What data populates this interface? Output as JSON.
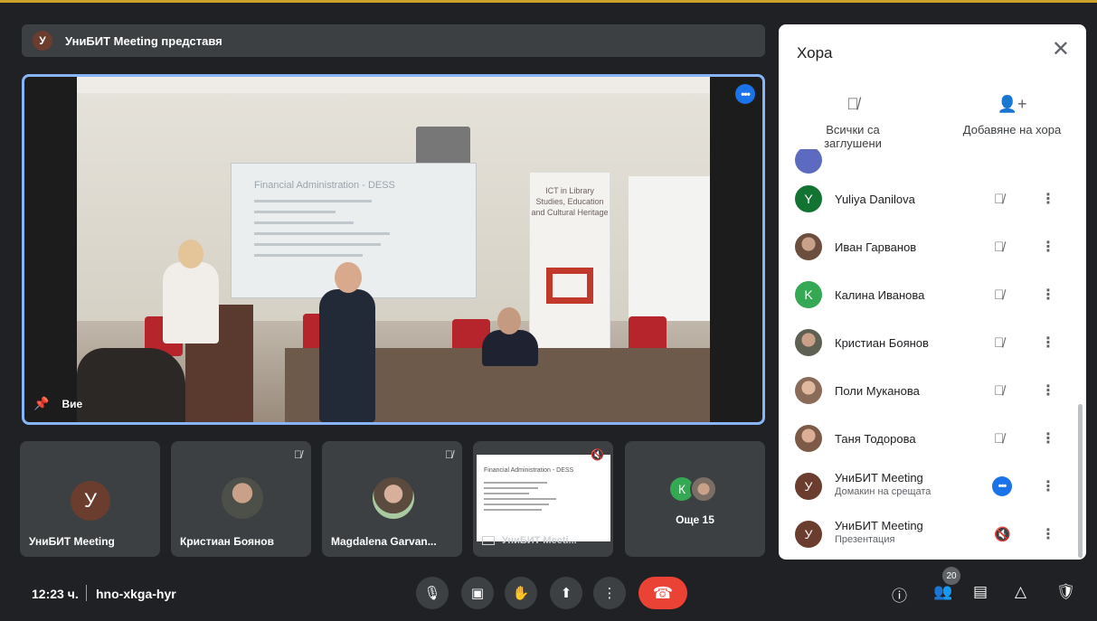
{
  "banner": {
    "avatar_letter": "У",
    "text": "УниБИТ Meeting представя"
  },
  "main_video": {
    "label": "Вие",
    "slide_title": "Financial Administration - DESS",
    "rollup_text": "ICT in Library Studies, Education and Cultural Heritage"
  },
  "tiles": [
    {
      "name": "УниБИТ Meeting",
      "avatar_letter": "У"
    },
    {
      "name": "Кристиан Боянов"
    },
    {
      "name": "Magdalena Garvan..."
    },
    {
      "name": "УниБИТ Meeti...",
      "slide_title": "Financial Administration - DESS"
    },
    {
      "more_label": "Още 15",
      "avatar_letter": "К"
    }
  ],
  "panel": {
    "title": "Хора",
    "mute_all_label": "Всички са заглушени",
    "add_people_label": "Добавяне на хора",
    "people": [
      {
        "name": "Yuliya Danilova",
        "letter": "Y",
        "color": "#137333"
      },
      {
        "name": "Иван Гарванов",
        "letter": "",
        "color": "#7a5a48"
      },
      {
        "name": "Калина Иванова",
        "letter": "K",
        "color": "#34a853"
      },
      {
        "name": "Кристиан Боянов",
        "letter": "",
        "color": "#6c6f5e"
      },
      {
        "name": "Поли Муканова",
        "letter": "",
        "color": "#a67c6a"
      },
      {
        "name": "Таня Тодорова",
        "letter": "",
        "color": "#8d6e63"
      },
      {
        "name": "УниБИТ Meeting",
        "sub": "Домакин на срещата",
        "letter": "У",
        "color": "#6b3d2e"
      },
      {
        "name": "УниБИТ Meeting",
        "sub": "Презентация",
        "letter": "У",
        "color": "#6b3d2e"
      }
    ]
  },
  "bottom": {
    "time": "12:23 ч.",
    "meeting_code": "hno-xkga-hyr",
    "participants_count": "20"
  },
  "colors": {
    "accent": "#1a73e8",
    "end_call": "#ea4335",
    "background": "#202124"
  }
}
